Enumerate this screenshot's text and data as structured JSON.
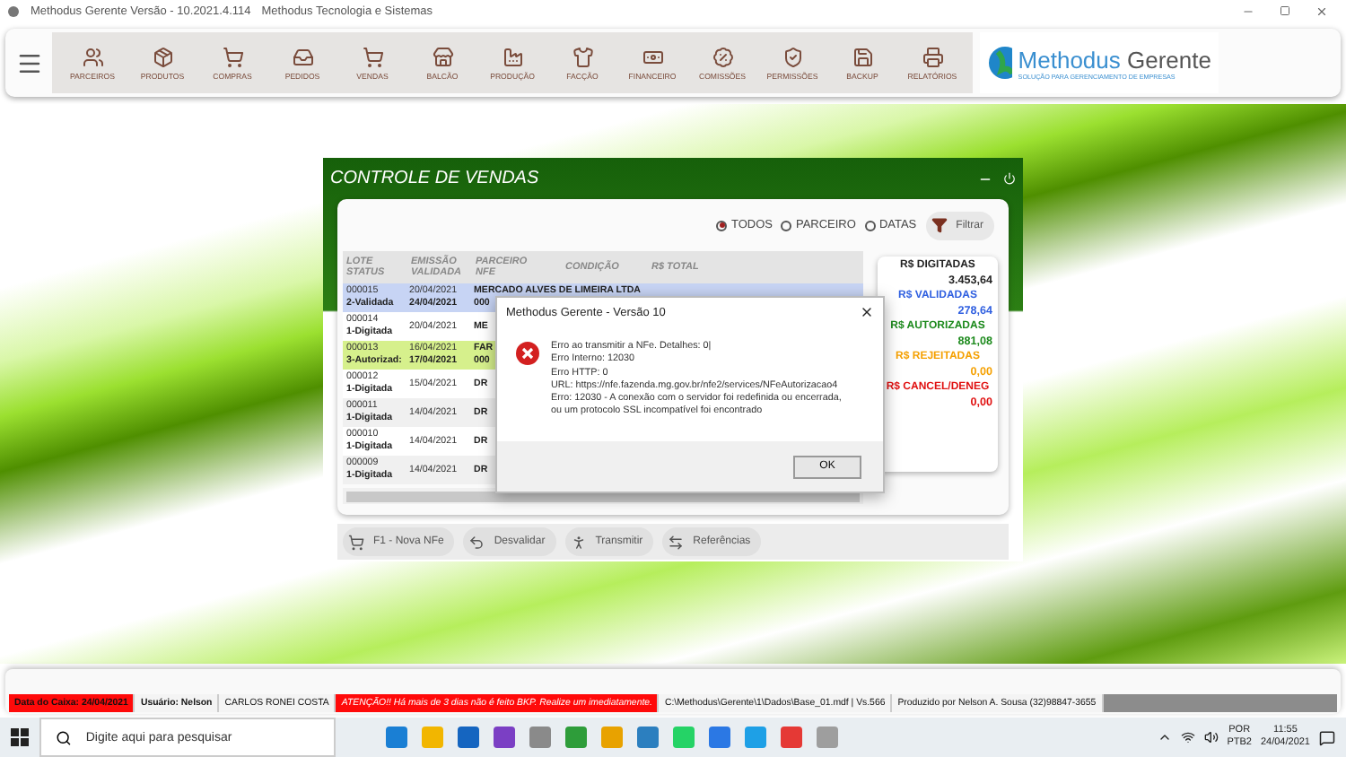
{
  "window": {
    "title": "Methodus Gerente  Versão - 10.2021.4.114",
    "subtitle": "Methodus Tecnologia e Sistemas"
  },
  "toolbar": {
    "items": [
      {
        "label": "PARCEIROS"
      },
      {
        "label": "PRODUTOS"
      },
      {
        "label": "COMPRAS"
      },
      {
        "label": "PEDIDOS"
      },
      {
        "label": "VENDAS"
      },
      {
        "label": "BALCÃO"
      },
      {
        "label": "PRODUÇÃO"
      },
      {
        "label": "FACÇÃO"
      },
      {
        "label": "FINANCEIRO"
      },
      {
        "label": "COMISSÕES"
      },
      {
        "label": "PERMISSÕES"
      },
      {
        "label": "BACKUP"
      },
      {
        "label": "RELATÓRIOS"
      }
    ],
    "logo": {
      "name": "Methodus",
      "product": "Gerente",
      "tagline": "SOLUÇÃO PARA GERENCIAMENTO DE EMPRESAS"
    }
  },
  "sales_window": {
    "title": "CONTROLE DE VENDAS",
    "filters": [
      {
        "label": "TODOS",
        "selected": true
      },
      {
        "label": "PARCEIRO",
        "selected": false
      },
      {
        "label": "DATAS",
        "selected": false
      }
    ],
    "filter_button": "Filtrar",
    "table": {
      "columns": [
        {
          "label": "LOTE",
          "sub": "STATUS"
        },
        {
          "label": "EMISSÃO",
          "sub": "VALIDADA"
        },
        {
          "label": "PARCEIRO",
          "sub": "NFE"
        },
        {
          "label": "CONDIÇÃO"
        },
        {
          "label": "R$ TOTAL"
        }
      ],
      "rows": [
        {
          "lote": "000015",
          "status": "2-Validada",
          "emissao": "20/04/2021",
          "validada": "24/04/2021",
          "parceiro": "MERCADO ALVES DE LIMEIRA LTDA",
          "nfe": "000",
          "color": "#c7d4f4"
        },
        {
          "lote": "000014",
          "status": "1-Digitada",
          "emissao": "20/04/2021",
          "parceiro": "ME",
          "color": "#ffffff"
        },
        {
          "lote": "000013",
          "status": "3-Autorizad:",
          "emissao": "16/04/2021",
          "validada": "17/04/2021",
          "parceiro": "FAR",
          "nfe": "000",
          "color": "#d6f08c"
        },
        {
          "lote": "000012",
          "status": "1-Digitada",
          "emissao": "15/04/2021",
          "parceiro": "DR",
          "color": "#ffffff"
        },
        {
          "lote": "000011",
          "status": "1-Digitada",
          "emissao": "14/04/2021",
          "parceiro": "DR",
          "color": "#f0f0f0"
        },
        {
          "lote": "000010",
          "status": "1-Digitada",
          "emissao": "14/04/2021",
          "parceiro": "DR",
          "color": "#ffffff"
        },
        {
          "lote": "000009",
          "status": "1-Digitada",
          "emissao": "14/04/2021",
          "parceiro": "DR",
          "color": "#f0f0f0"
        }
      ]
    },
    "totals": [
      {
        "label": "R$ DIGITADAS",
        "value": "3.453,64",
        "color": "#222222"
      },
      {
        "label": "R$ VALIDADAS",
        "value": "278,64",
        "color": "#2f5fe0"
      },
      {
        "label": "R$ AUTORIZADAS",
        "value": "881,08",
        "color": "#1d8a1d"
      },
      {
        "label": "R$ REJEITADAS",
        "value": "0,00",
        "color": "#f5a000"
      },
      {
        "label": "R$ CANCEL/DENEG",
        "value": "0,00",
        "color": "#e01010"
      }
    ],
    "actions": [
      {
        "label": "F1 - Nova NFe"
      },
      {
        "label": "Desvalidar"
      },
      {
        "label": "Transmitir"
      },
      {
        "label": "Referências"
      }
    ]
  },
  "dialog": {
    "title": "Methodus Gerente - Versão 10",
    "lines": [
      "Erro ao transmitir a NFe. Detalhes: 0|",
      "Erro Interno: 12030",
      "Erro HTTP: 0",
      "URL: https://nfe.fazenda.mg.gov.br/nfe2/services/NFeAutorizacao4",
      "Erro: 12030 - A conexão com o servidor foi redefinida ou encerrada, ou um protocolo SSL incompatível foi encontrado"
    ],
    "button": "OK"
  },
  "status_bar": [
    {
      "text": "Data do Caixa: 24/04/2021",
      "kind": "alert"
    },
    {
      "text": "Usuário: Nelson",
      "kind": "bold"
    },
    {
      "text": "CARLOS RONEI COSTA",
      "kind": "plain"
    },
    {
      "text": "ATENÇÃO!! Há mais de 3 dias não é feito BKP. Realize um imediatamente.",
      "kind": "warning"
    },
    {
      "text": "C:\\Methodus\\Gerente\\1\\Dados\\Base_01.mdf | Vs.566",
      "kind": "plain"
    },
    {
      "text": "Produzido por Nelson A. Sousa (32)98847-3655",
      "kind": "plain"
    }
  ],
  "taskbar": {
    "search_placeholder": "Digite aqui para pesquisar",
    "language": "POR",
    "layout": "PTB2",
    "time": "11:55",
    "date": "24/04/2021"
  }
}
